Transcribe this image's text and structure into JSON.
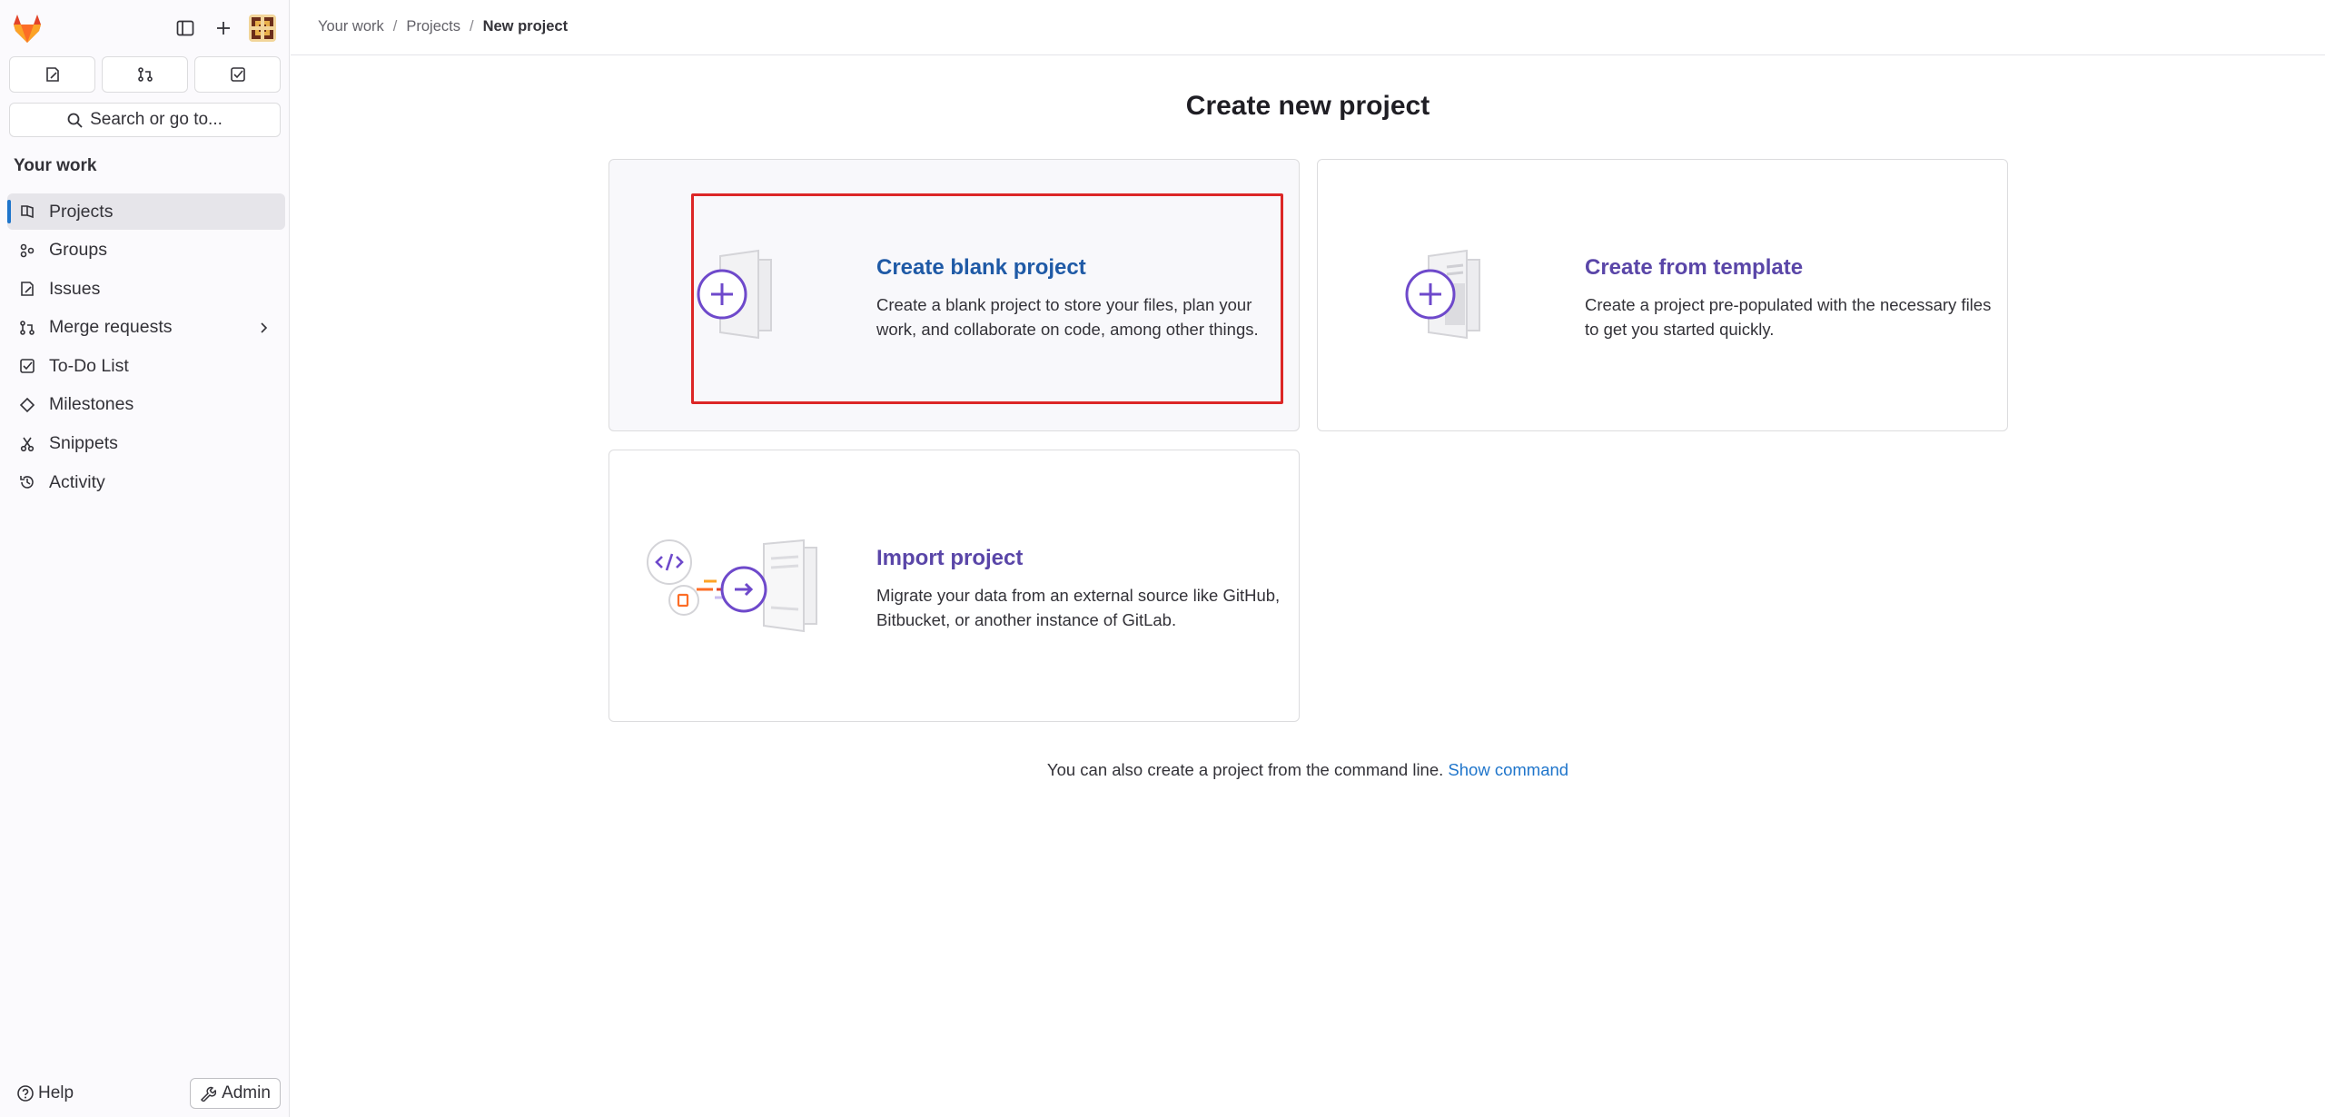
{
  "sidebar": {
    "search_label": "Search or go to...",
    "section_title": "Your work",
    "items": [
      {
        "label": "Projects",
        "icon": "project-icon",
        "active": true
      },
      {
        "label": "Groups",
        "icon": "group-icon"
      },
      {
        "label": "Issues",
        "icon": "issues-icon"
      },
      {
        "label": "Merge requests",
        "icon": "merge-request-icon",
        "has_submenu": true
      },
      {
        "label": "To-Do List",
        "icon": "todo-icon"
      },
      {
        "label": "Milestones",
        "icon": "milestone-icon"
      },
      {
        "label": "Snippets",
        "icon": "snippet-icon"
      },
      {
        "label": "Activity",
        "icon": "history-icon"
      }
    ],
    "help_label": "Help",
    "admin_label": "Admin"
  },
  "breadcrumb": {
    "items": [
      "Your work",
      "Projects",
      "New project"
    ],
    "separator": "/"
  },
  "main": {
    "title": "Create new project",
    "cards": [
      {
        "title": "Create blank project",
        "description": "Create a blank project to store your files, plan your work, and collaborate on code, among other things."
      },
      {
        "title": "Create from template",
        "description": "Create a project pre-populated with the necessary files to get you started quickly."
      },
      {
        "title": "Import project",
        "description": "Migrate your data from an external source like GitHub, Bitbucket, or another instance of GitLab."
      }
    ],
    "cli_text": "You can also create a project from the command line.",
    "cli_link": "Show command"
  },
  "colors": {
    "accent_purple": "#6e49cb",
    "highlight_red": "#dc2626",
    "link_blue": "#1f75cb"
  }
}
